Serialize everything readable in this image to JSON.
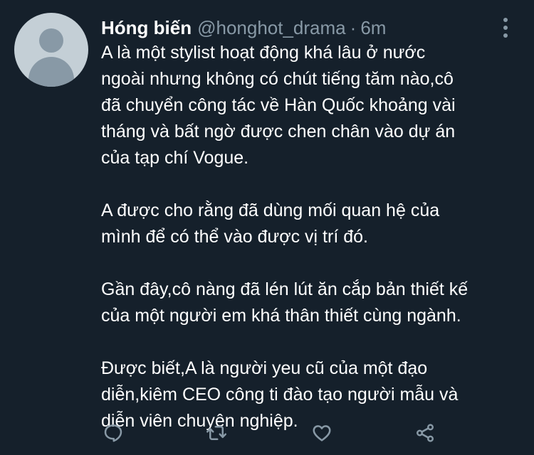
{
  "tweet": {
    "author": {
      "display_name": "Hóng biến",
      "handle": "@honghot_drama",
      "separator": "·",
      "time": "6m"
    },
    "paragraphs": [
      [
        "A là một stylist hoạt động khá lâu ở nước",
        "ngoài nhưng không có chút tiếng tăm nào,cô",
        "đã chuyển công tác về Hàn Quốc khoảng vài",
        "tháng và bất ngờ được chen chân vào dự án",
        "của tạp chí Vogue."
      ],
      [
        "A được cho rằng đã dùng mối quan hệ của",
        "mình để có thể vào được vị trí đó."
      ],
      [
        "Gần đây,cô nàng đã lén lút ăn cắp bản thiết kế",
        "của một người em khá thân thiết cùng ngành."
      ],
      [
        "Được biết,A là người yeu cũ của một đạo",
        "diễn,kiêm CEO công ti đào tạo người mẫu và",
        "diễn viên chuyên nghiệp."
      ]
    ],
    "actions": {
      "reply_icon": "reply-icon",
      "retweet_icon": "retweet-icon",
      "like_icon": "heart-icon",
      "share_icon": "share-icon",
      "icon_color": "#8899a6"
    },
    "colors": {
      "background": "#15202b",
      "text": "#ffffff",
      "muted": "#8899a6"
    }
  }
}
